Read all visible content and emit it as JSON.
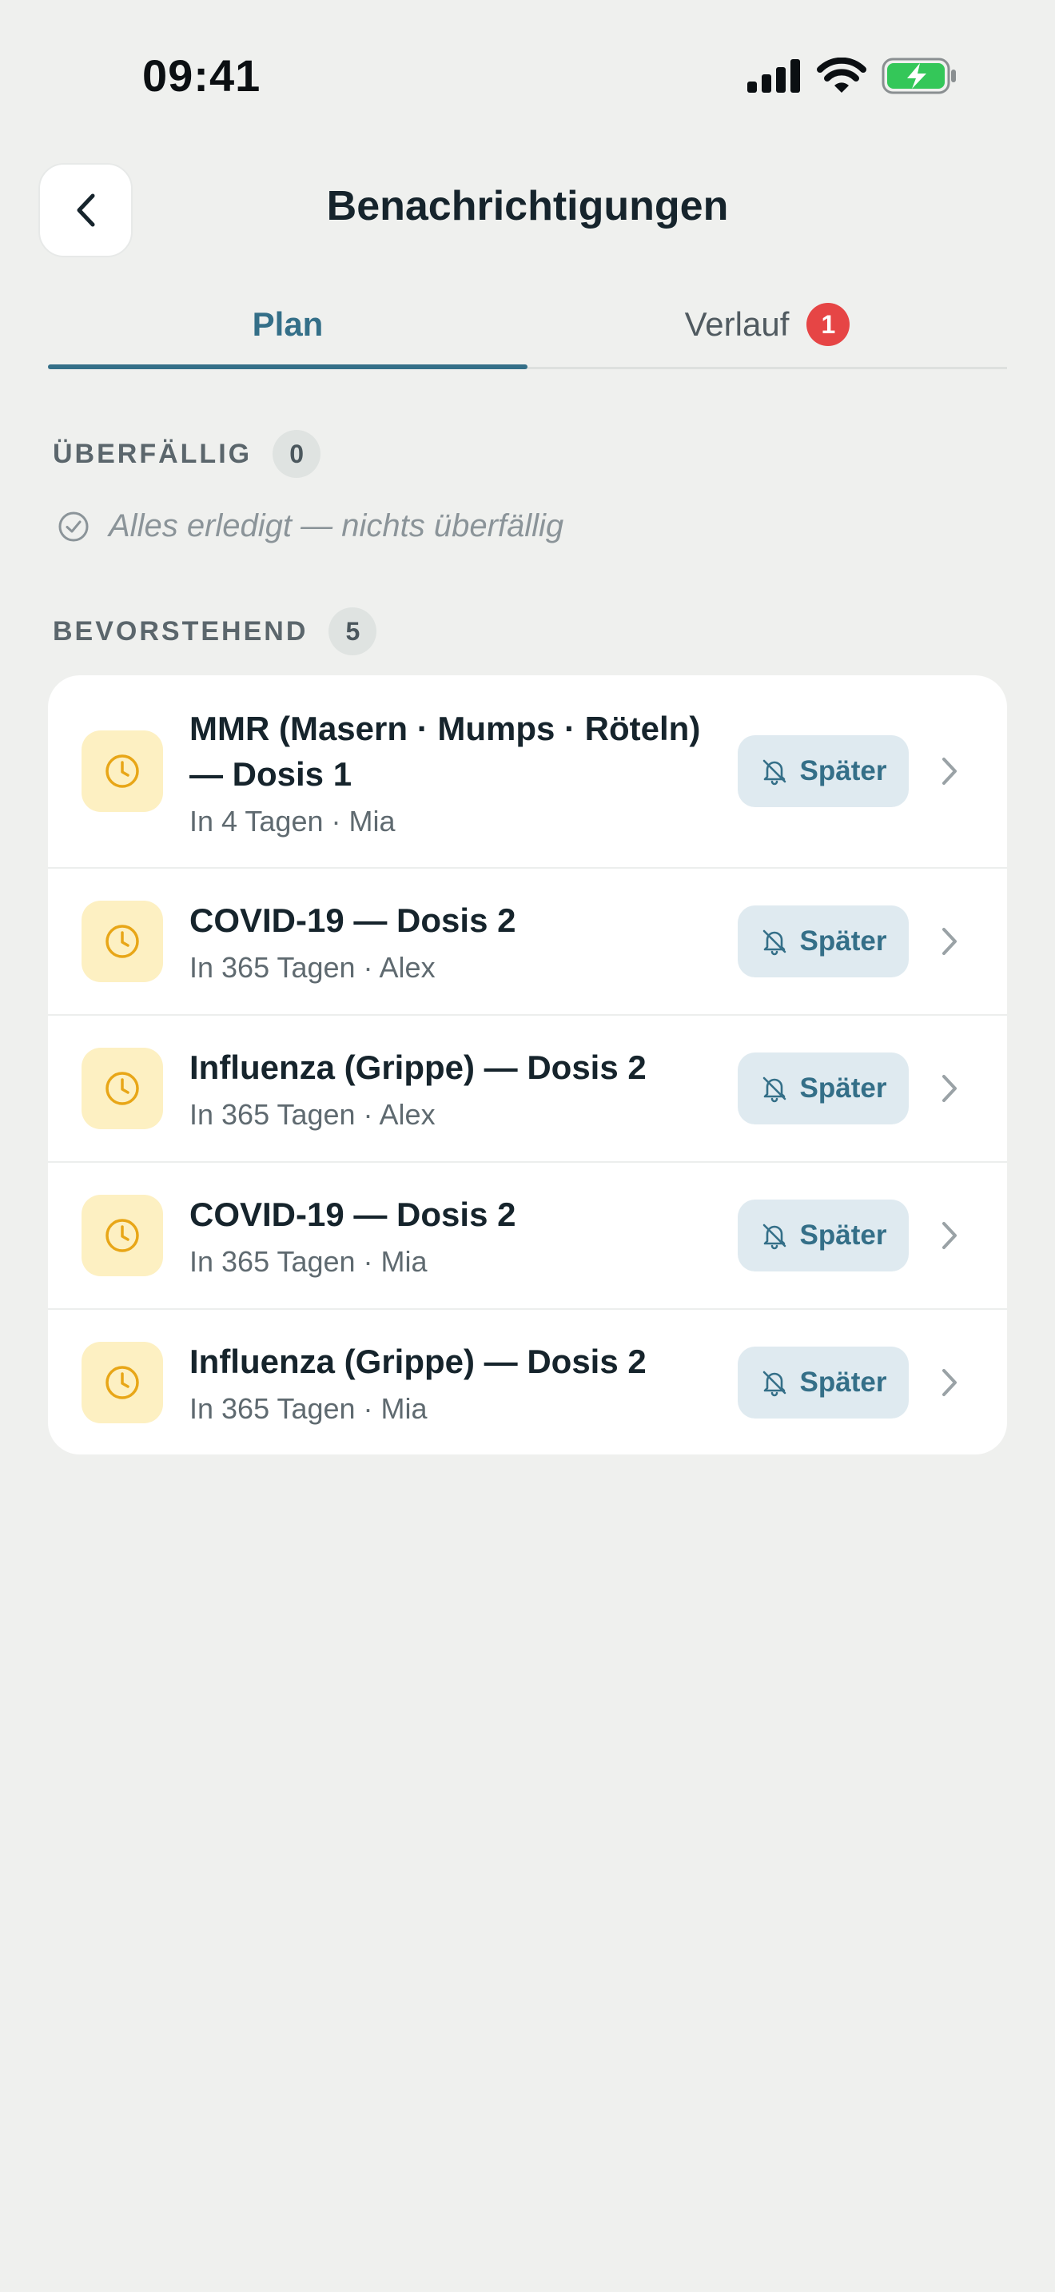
{
  "status_bar": {
    "time": "09:41",
    "icons": [
      "signal-icon",
      "wifi-icon",
      "battery-charging-icon"
    ],
    "battery_color": "#34c759"
  },
  "header": {
    "title": "Benachrichtigungen",
    "back_icon": "chevron-left-icon"
  },
  "tabs": [
    {
      "label": "Plan",
      "active": true
    },
    {
      "label": "Verlauf",
      "active": false,
      "badge": "1"
    }
  ],
  "overdue": {
    "label": "ÜBERFÄLLIG",
    "count": "0",
    "empty_text": "Alles erledigt — nichts überfällig",
    "empty_icon": "check-circle-icon"
  },
  "upcoming": {
    "label": "BEVORSTEHEND",
    "count": "5",
    "items": [
      {
        "title": "MMR (Masern · Mumps · Röteln) — Dosis 1",
        "subtitle": "In 4 Tagen · Mia",
        "action": "Später",
        "icon": "clock-icon"
      },
      {
        "title": "COVID-19 — Dosis 2",
        "subtitle": "In 365 Tagen · Alex",
        "action": "Später",
        "icon": "clock-icon"
      },
      {
        "title": "Influenza (Grippe) — Dosis 2",
        "subtitle": "In 365 Tagen · Alex",
        "action": "Später",
        "icon": "clock-icon"
      },
      {
        "title": "COVID-19 — Dosis 2",
        "subtitle": "In 365 Tagen · Mia",
        "action": "Später",
        "icon": "clock-icon"
      },
      {
        "title": "Influenza (Grippe) — Dosis 2",
        "subtitle": "In 365 Tagen · Mia",
        "action": "Später",
        "icon": "clock-icon"
      }
    ]
  },
  "colors": {
    "accent": "#346f88",
    "badge_red": "#e64545",
    "clock_amber": "#e8a617",
    "clock_bg": "#fdf0c2",
    "snooze_bg": "#dfeaf0",
    "background": "#eff0ee"
  }
}
